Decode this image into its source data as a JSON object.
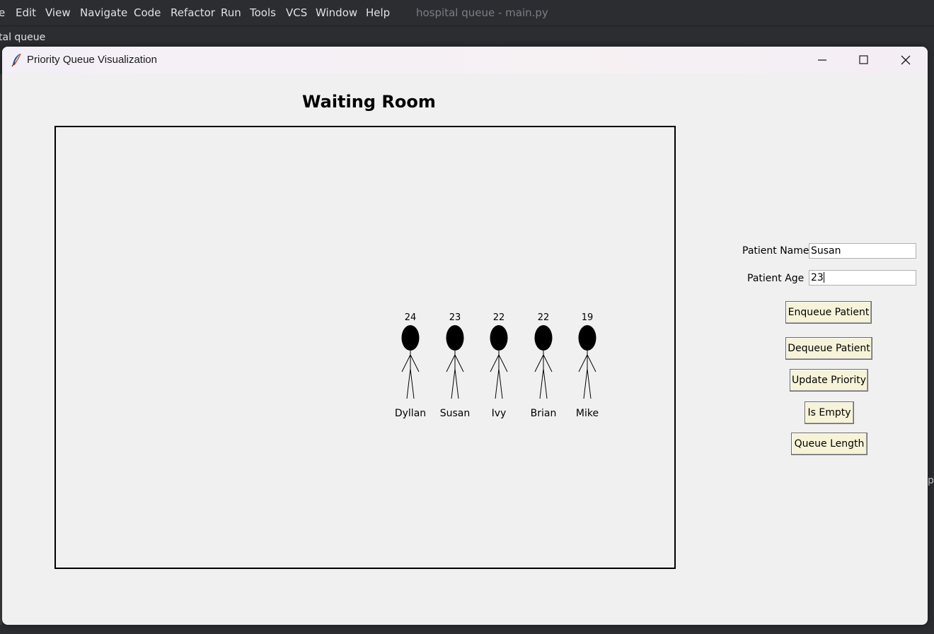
{
  "ide": {
    "menu": [
      {
        "label": "e"
      },
      {
        "label": "Edit"
      },
      {
        "label": "View"
      },
      {
        "label": "Navigate"
      },
      {
        "label": "Code"
      },
      {
        "label": "Refactor"
      },
      {
        "label": "Run"
      },
      {
        "label": "Tools"
      },
      {
        "label": "VCS"
      },
      {
        "label": "Window"
      },
      {
        "label": "Help"
      }
    ],
    "title": "hospital queue - main.py",
    "breadcrumb": "tal queue",
    "right_fragment": "p"
  },
  "window": {
    "title": "Priority Queue Visualization",
    "icon": "feather-icon",
    "controls": [
      "minimize-icon",
      "maximize-icon",
      "close-icon"
    ]
  },
  "main": {
    "heading": "Waiting Room",
    "patients": [
      {
        "name": "Dyllan",
        "age": "24"
      },
      {
        "name": "Susan",
        "age": "23"
      },
      {
        "name": "Ivy",
        "age": "22"
      },
      {
        "name": "Brian",
        "age": "22"
      },
      {
        "name": "Mike",
        "age": "19"
      }
    ]
  },
  "form": {
    "name_label": "Patient Name",
    "name_value": "Susan",
    "age_label": "Patient Age",
    "age_value": "23"
  },
  "buttons": {
    "enqueue": "Enqueue Patient",
    "dequeue": "Dequeue Patient",
    "update": "Update Priority",
    "is_empty": "Is Empty",
    "length": "Queue Length"
  },
  "colors": {
    "button_bg": "#f7f3d8",
    "window_bg": "#f0f0f0",
    "ide_bg": "#2b2d30"
  }
}
